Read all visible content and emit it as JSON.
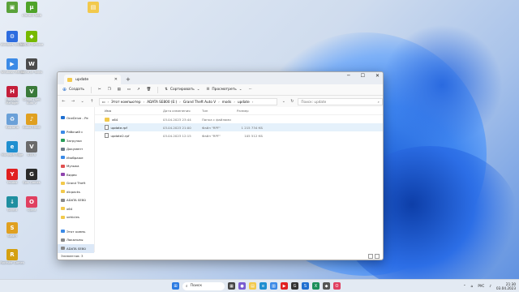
{
  "desktop": {
    "icons": [
      {
        "label": "",
        "color": "#5aa23a",
        "glyph": "▣"
      },
      {
        "label": "uTorrent Web",
        "color": "#4ea329",
        "glyph": "µ"
      },
      {
        "label": "",
        "color": "#f2c94c",
        "glyph": "▤"
      },
      {
        "label": "Windows Shorts",
        "color": "#2d6cdf",
        "glyph": "⚙"
      },
      {
        "label": "NVIDIA GeForce",
        "color": "#77b900",
        "glyph": "◆"
      },
      {
        "label": "Windows Media",
        "color": "#3b8ae6",
        "glyph": "▶"
      },
      {
        "label": "World of Tanks",
        "color": "#4b4b4b",
        "glyph": "W"
      },
      {
        "label": "Hamachi Manager",
        "color": "#c41e3a",
        "glyph": "H"
      },
      {
        "label": "Grand Theft Auto V",
        "color": "#3a7a3a",
        "glyph": "V"
      },
      {
        "label": "Корзина",
        "color": "#6aa0d8",
        "glyph": "♻"
      },
      {
        "label": "Audio Effect",
        "color": "#e0a020",
        "glyph": "♪"
      },
      {
        "label": "Microsoft Edge",
        "color": "#1f8fd0",
        "glyph": "e"
      },
      {
        "label": "GTA V",
        "color": "#6a6a6a",
        "glyph": "V"
      },
      {
        "label": "Yandex",
        "color": "#e02020",
        "glyph": "Y"
      },
      {
        "label": "Epic Games",
        "color": "#2a2a2a",
        "glyph": "G"
      },
      {
        "label": "Torrent",
        "color": "#1f8fa0",
        "glyph": "↓"
      },
      {
        "label": "Opera",
        "color": "#e04060",
        "glyph": "O"
      },
      {
        "label": "Steam",
        "color": "#e0a020",
        "glyph": "S"
      },
      {
        "label": "Rockstar Games",
        "color": "#d4a010",
        "glyph": "R"
      }
    ]
  },
  "window": {
    "tab_title": "update",
    "commands": {
      "create": "Создать",
      "sort": "Сортировать",
      "view": "Просмотреть",
      "more": "···"
    },
    "breadcrumb": [
      "Этот компьютер",
      "ADATA SE800 (E:)",
      "Grand Theft Auto V",
      "mods",
      "update"
    ],
    "search_placeholder": "Поиск: update",
    "nav": [
      {
        "label": "OneDrive - Pe",
        "color": "#1f6fd0"
      },
      {
        "label": "Рабочий с",
        "color": "#3b8ae6"
      },
      {
        "label": "Загрузки",
        "color": "#2a9d5a"
      },
      {
        "label": "Документ",
        "color": "#6c7a89"
      },
      {
        "label": "Изображе",
        "color": "#3b8ae6"
      },
      {
        "label": "Музыка",
        "color": "#e05050"
      },
      {
        "label": "Видео",
        "color": "#8e44ad"
      },
      {
        "label": "Grand Theft",
        "color": "#f2c94c"
      },
      {
        "label": "dlcpacks",
        "color": "#f2c94c"
      },
      {
        "label": "ADATA SE80",
        "color": "#888888"
      },
      {
        "label": "x64",
        "color": "#f2c94c"
      },
      {
        "label": "vehicles",
        "color": "#f2c94c"
      },
      {
        "label": "Этот компь",
        "color": "#3b8ae6"
      },
      {
        "label": "Локальны",
        "color": "#888888"
      },
      {
        "label": "ADATA SE80",
        "color": "#888888"
      }
    ],
    "columns": {
      "name": "Имя",
      "date": "Дата изменения",
      "type": "Тип",
      "size": "Размер"
    },
    "files": [
      {
        "name": "x64",
        "date": "03.04.2023 23:44",
        "type": "Папка с файлами",
        "size": "",
        "kind": "folder"
      },
      {
        "name": "update.rpf",
        "date": "03.04.2023 21:00",
        "type": "Файл \"RPF\"",
        "size": "1 215 734 КБ",
        "kind": "file"
      },
      {
        "name": "update2.rpf",
        "date": "03.04.2023 12:15",
        "type": "Файл \"RPF\"",
        "size": "105 512 КБ",
        "kind": "file"
      }
    ],
    "status": "Элементов: 3"
  },
  "taskbar": {
    "search": "Поиск",
    "lang": "РУС",
    "time": "21:30",
    "date": "03.04.2023"
  }
}
